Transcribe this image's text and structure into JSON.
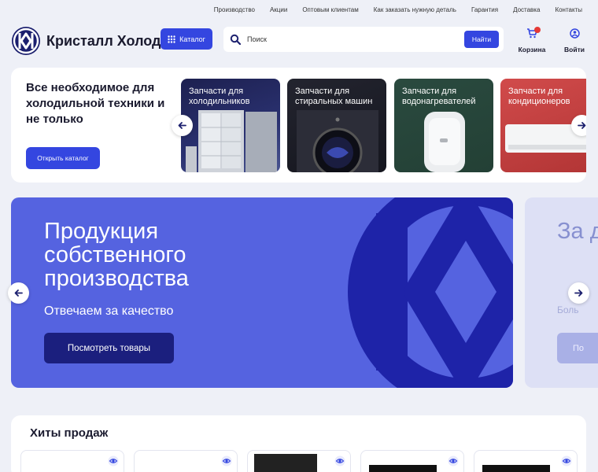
{
  "topnav": {
    "links": [
      "Производство",
      "Акции",
      "Оптовым клиентам",
      "Как заказать нужную деталь",
      "Гарантия",
      "Доставка",
      "Контакты"
    ]
  },
  "header": {
    "brand": "Кристалл Холод",
    "catalog_label": "Каталог",
    "search_placeholder": "Поиск",
    "search_button": "Найти",
    "cart_label": "Корзина",
    "login_label": "Войти"
  },
  "promo": {
    "title": "Все необходимое для холодильной техники и не только",
    "button": "Открыть каталог",
    "tiles": [
      {
        "label": "Запчасти для холодильников",
        "color": "#23295e"
      },
      {
        "label": "Запчасти для стиральных машин",
        "color": "#1c1d2c"
      },
      {
        "label": "Запчасти для водонагревателей",
        "color": "#2e4a3e"
      },
      {
        "label": "Запчасти для кондиционеров",
        "color": "#c93f3f"
      }
    ]
  },
  "banner": {
    "title": "Продукция собственного производства",
    "subtitle": "Отвечаем за качество",
    "button": "Посмотреть товары"
  },
  "banner_next": {
    "title": "За дл ма",
    "subtitle": "Боль",
    "button": "По"
  },
  "hits": {
    "title": "Хиты продаж"
  },
  "colors": {
    "accent": "#3446e0",
    "brand_dark": "#1b1f6e",
    "banner": "#5563e0"
  }
}
